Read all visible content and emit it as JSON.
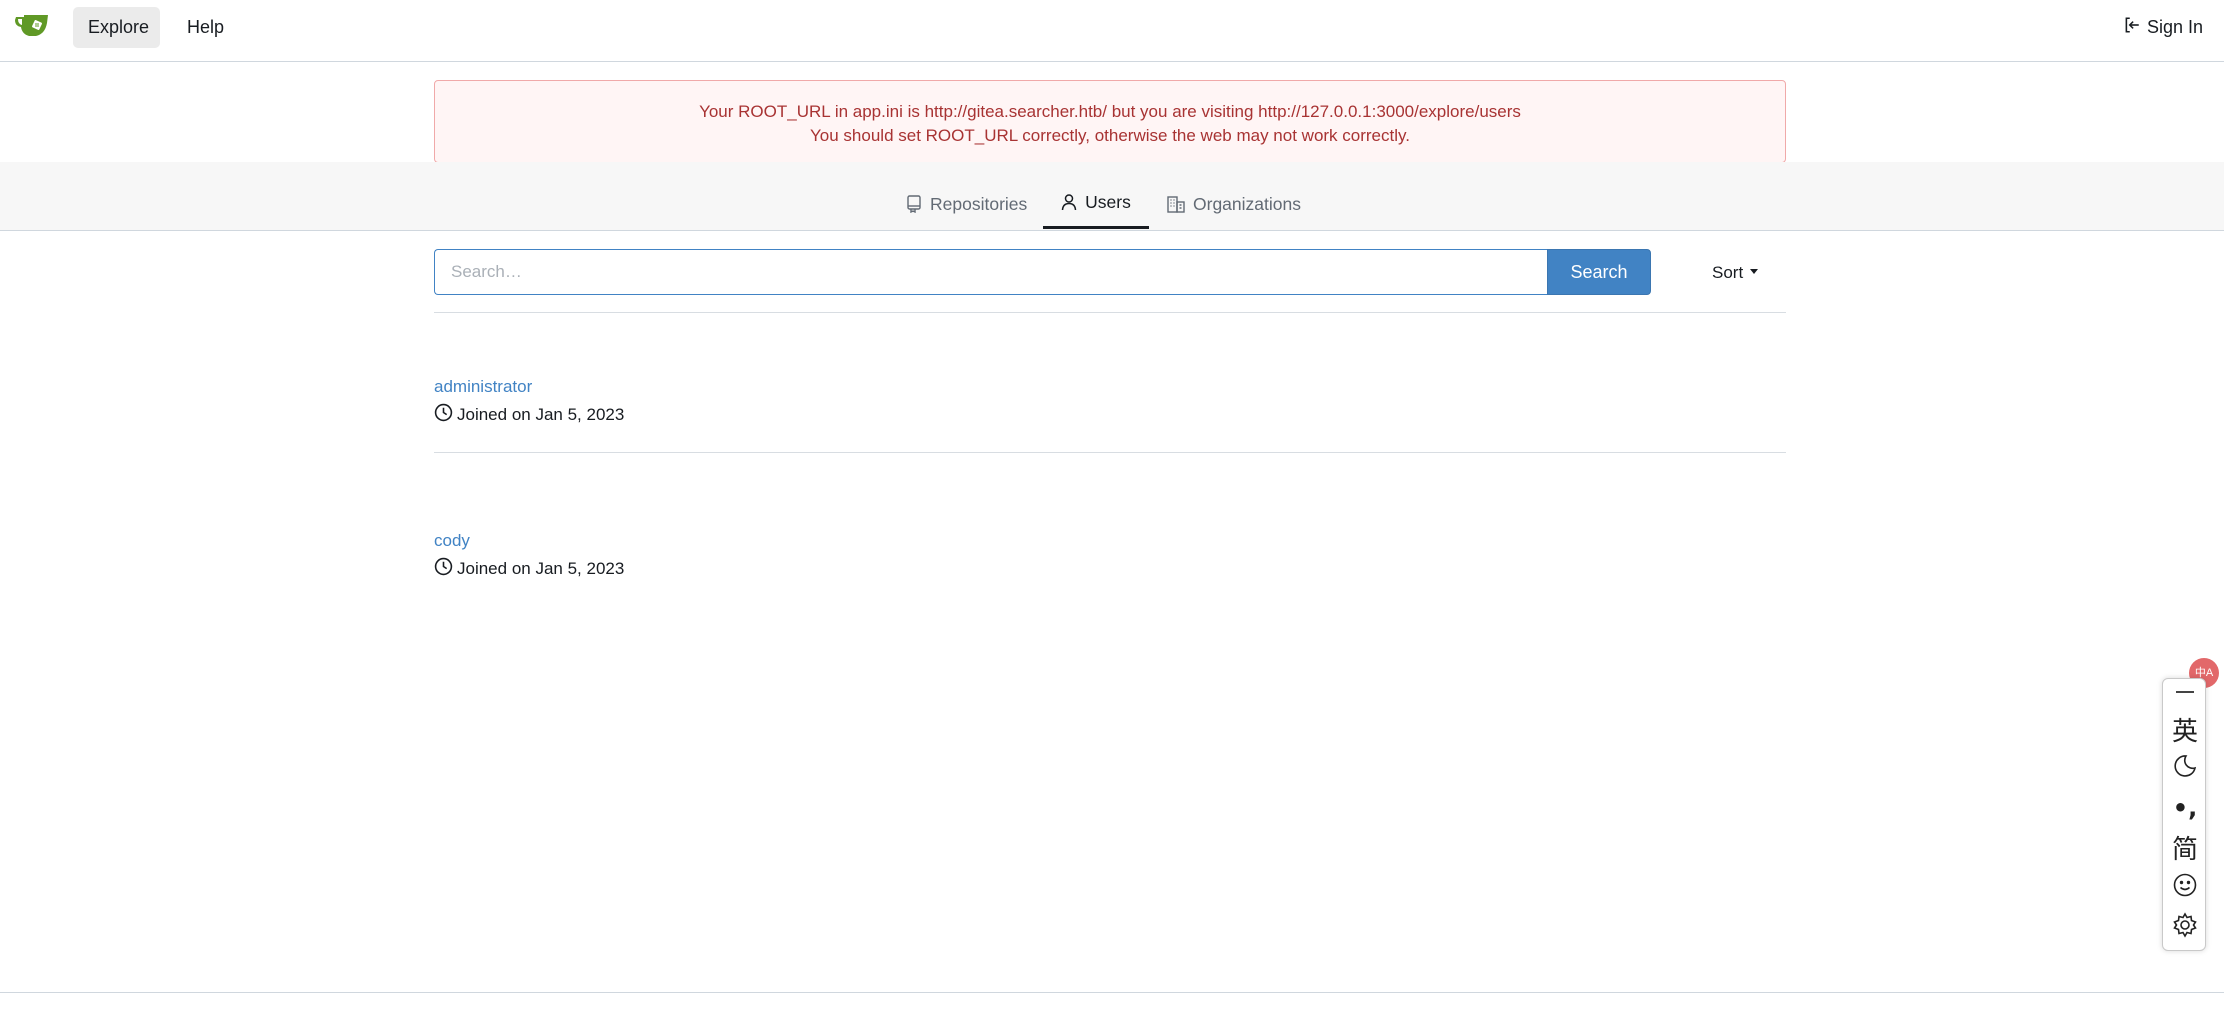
{
  "nav": {
    "explore": "Explore",
    "help": "Help",
    "sign_in": "Sign In"
  },
  "alert": {
    "line1": "Your ROOT_URL in app.ini is http://gitea.searcher.htb/ but you are visiting http://127.0.0.1:3000/explore/users",
    "line2": "You should set ROOT_URL correctly, otherwise the web may not work correctly."
  },
  "tabs": [
    {
      "label": "Repositories",
      "icon": "repo-icon",
      "active": false
    },
    {
      "label": "Users",
      "icon": "person-icon",
      "active": true
    },
    {
      "label": "Organizations",
      "icon": "organization-icon",
      "active": false
    }
  ],
  "search": {
    "placeholder": "Search…",
    "value": "",
    "button": "Search"
  },
  "sort": {
    "label": "Sort"
  },
  "users": [
    {
      "name": "administrator",
      "joined": "Joined on Jan 5, 2023"
    },
    {
      "name": "cody",
      "joined": "Joined on Jan 5, 2023"
    }
  ],
  "ime_toolbar": {
    "badge": "中A",
    "items": [
      "英",
      "moon-icon",
      "punctuation-icon",
      "简",
      "smiley-icon",
      "gear-icon"
    ],
    "labels": {
      "english": "英",
      "simplified": "简",
      "punct": "•,"
    }
  },
  "colors": {
    "accent": "#4183c4",
    "alert_text": "#a83333",
    "alert_bg": "#fff5f5",
    "logo_green": "#609926"
  }
}
